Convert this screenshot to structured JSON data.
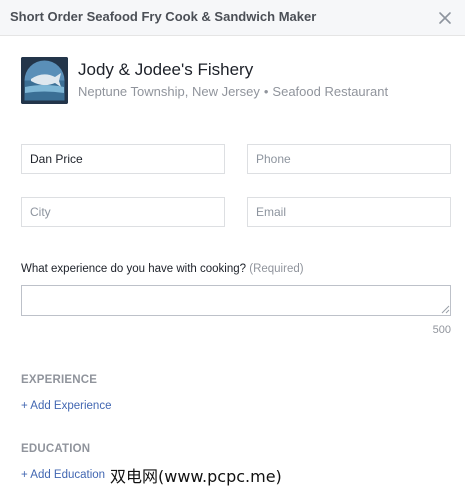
{
  "header": {
    "title": "Short Order Seafood Fry Cook & Sandwich Maker"
  },
  "business": {
    "name": "Jody & Jodee's Fishery",
    "location": "Neptune Township, New Jersey",
    "separator": "•",
    "category": "Seafood Restaurant"
  },
  "form": {
    "name_value": "Dan Price",
    "phone_placeholder": "Phone",
    "city_placeholder": "City",
    "email_placeholder": "Email",
    "question_text": "What experience do you have with cooking?",
    "question_required": "(Required)",
    "char_limit": "500"
  },
  "experience": {
    "heading": "EXPERIENCE",
    "add_label": "+ Add Experience"
  },
  "education": {
    "heading": "EDUCATION",
    "add_label": "+ Add Education"
  },
  "watermark": {
    "text": "双电网(www.pcpc.me)"
  },
  "colors": {
    "link": "#4267b2",
    "muted": "#90949c",
    "header_bg": "#f6f7f9"
  }
}
